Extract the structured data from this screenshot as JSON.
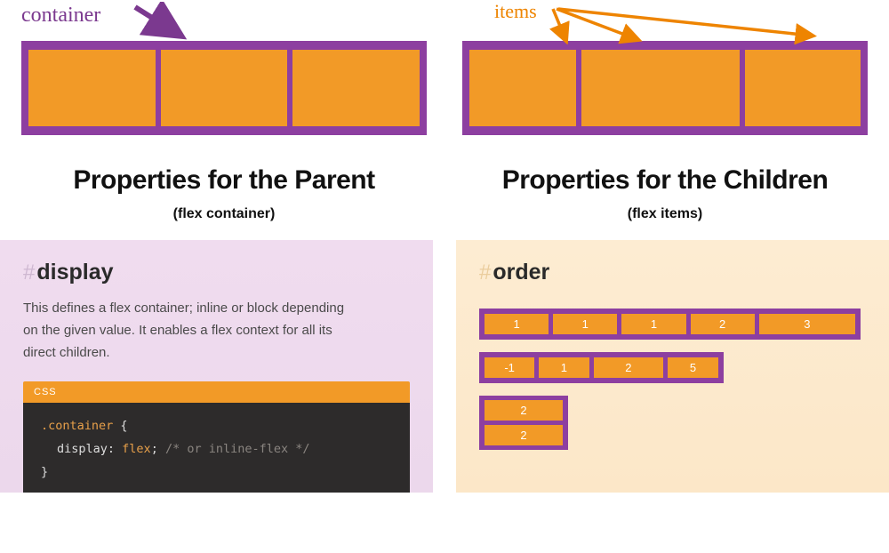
{
  "labels": {
    "container": "container",
    "items": "items"
  },
  "headlines": {
    "parent_title": "Properties for the Parent",
    "parent_sub": "(flex container)",
    "children_title": "Properties for the Children",
    "children_sub": "(flex items)"
  },
  "panel_left": {
    "heading": "display",
    "desc": "This defines a flex container; inline or block depending on the given value. It enables a flex context for all its direct children.",
    "code_lang": "CSS",
    "code": {
      "selector": ".container",
      "open": "{",
      "prop": "display",
      "colon": ": ",
      "value": "flex",
      "semi": ";",
      "comment": "/* or inline-flex */",
      "close": "}"
    }
  },
  "panel_right": {
    "heading": "order",
    "row1": [
      "1",
      "1",
      "1",
      "2",
      "3"
    ],
    "row2": [
      "-1",
      "1",
      "2",
      "5"
    ],
    "col": [
      "2",
      "2"
    ]
  },
  "colors": {
    "purple": "#8d3fa0",
    "orange": "#f29a27",
    "label_purple": "#7b398f",
    "label_orange": "#ee8400"
  }
}
